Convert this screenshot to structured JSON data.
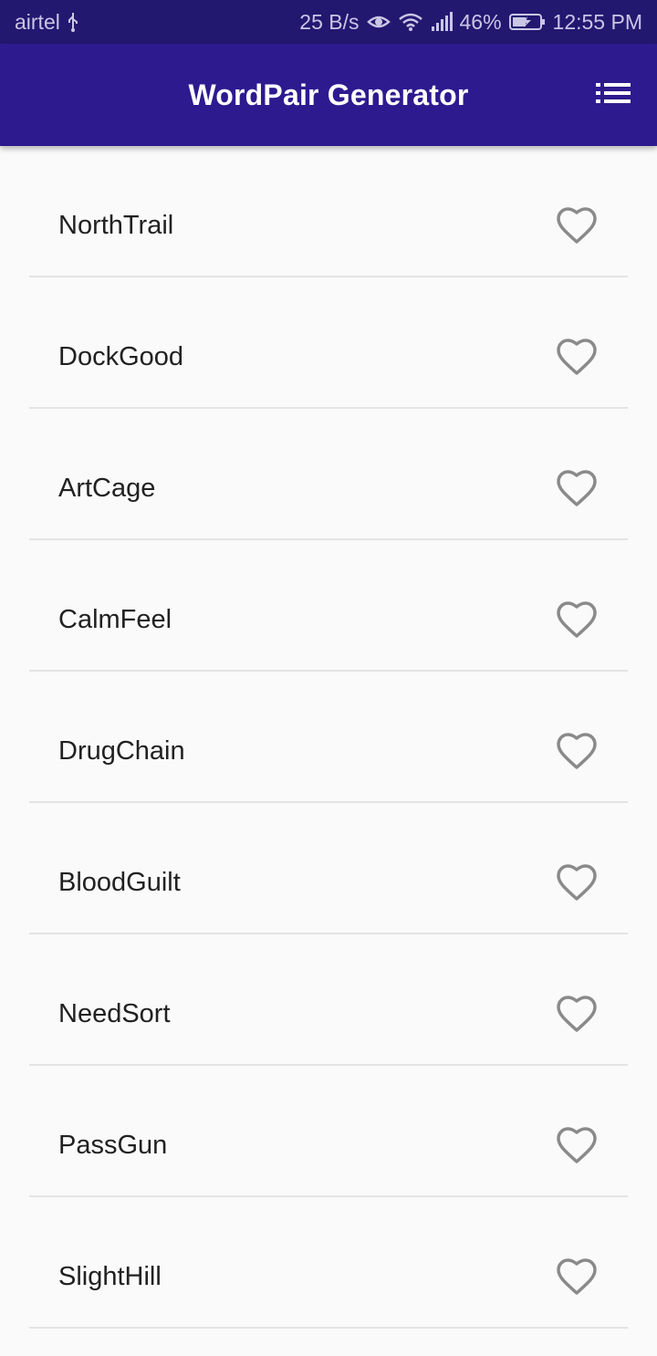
{
  "status_bar": {
    "carrier": "airtel",
    "usb_icon": "usb-icon",
    "net_speed": "25 B/s",
    "eye_icon": "eye-comfort-icon",
    "wifi_icon": "wifi-icon",
    "signal_icon": "signal-icon",
    "battery_percent": "46%",
    "battery_icon": "battery-charging-icon",
    "time": "12:55 PM"
  },
  "app_bar": {
    "title": "WordPair Generator",
    "menu_icon": "list-icon",
    "background": "#2e1a8f",
    "status_background": "#221870"
  },
  "word_pairs": [
    {
      "label": "NorthTrail",
      "favorite": false
    },
    {
      "label": "DockGood",
      "favorite": false
    },
    {
      "label": "ArtCage",
      "favorite": false
    },
    {
      "label": "CalmFeel",
      "favorite": false
    },
    {
      "label": "DrugChain",
      "favorite": false
    },
    {
      "label": "BloodGuilt",
      "favorite": false
    },
    {
      "label": "NeedSort",
      "favorite": false
    },
    {
      "label": "PassGun",
      "favorite": false
    },
    {
      "label": "SlightHill",
      "favorite": false
    }
  ],
  "colors": {
    "heart_outline": "#8a8a8a",
    "divider": "#e4e4e4",
    "text": "#212121"
  }
}
